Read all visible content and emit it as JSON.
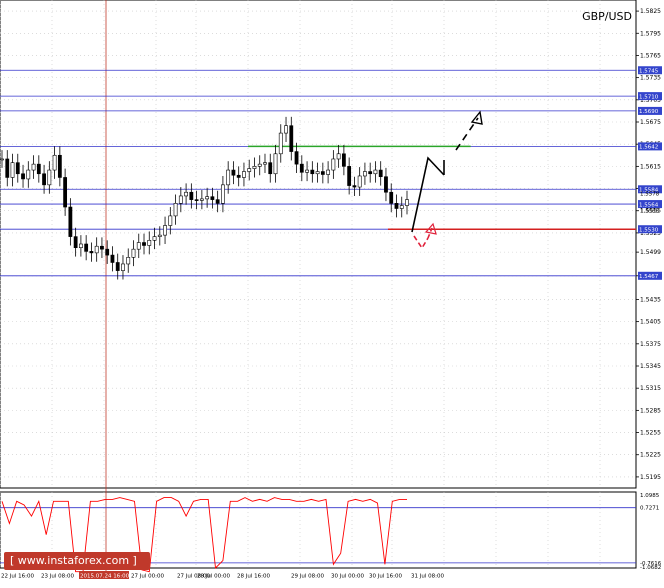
{
  "symbol": "GBP/USD",
  "watermark": "[ www.instaforex.com ]",
  "colors": {
    "grid": "#c8c8c8",
    "blue_level": "#3333cc",
    "green_level": "#2aa52a",
    "red_level": "#d42020",
    "candles": "#000000",
    "oscillator": "#ff0000",
    "arrow_black": "#000000",
    "arrow_red": "#e0203a",
    "date_marker": "#c0392b"
  },
  "chart_data": [
    {
      "type": "candlestick",
      "title": "GBP/USD",
      "y_ticks": [
        "1.5825",
        "1.5795",
        "1.5765",
        "1.5735",
        "1.5705",
        "1.5675",
        "1.5645",
        "1.5615",
        "1.5585",
        "1.5555",
        "1.5525",
        "1.5499",
        "1.5467",
        "1.5435",
        "1.5405",
        "1.5375",
        "1.5345",
        "1.5315",
        "1.5285",
        "1.5255",
        "1.5225",
        "1.5195"
      ],
      "x_ticks": [
        "22 Jul 16:00",
        "23 Jul 08:00",
        "2015.07.24 16:00",
        "27 Jul 00:00",
        "27 Jul 08:00",
        "28 Jul 00:00",
        "28 Jul 16:00",
        "29 Jul 08:00",
        "30 Jul 00:00",
        "30 Jul 16:00",
        "31 Jul 08:00"
      ],
      "ylim": [
        1.518,
        1.584
      ],
      "levels": [
        {
          "value": 1.5745,
          "label": "1.5745",
          "color": "blue"
        },
        {
          "value": 1.571,
          "label": "1.5710",
          "color": "blue"
        },
        {
          "value": 1.569,
          "label": "1.5690",
          "color": "blue"
        },
        {
          "value": 1.5642,
          "label": "1.5642",
          "color": "blue"
        },
        {
          "value": 1.5584,
          "label": "1.5584",
          "color": "blue"
        },
        {
          "value": 1.5564,
          "label": "1.5564",
          "color": "blue"
        },
        {
          "value": 1.553,
          "label": "1.5530",
          "color": "blue"
        },
        {
          "value": 1.5467,
          "label": "1.5467",
          "color": "blue"
        }
      ],
      "extra_price_labels": [
        "1.5578",
        "1.5555"
      ],
      "green_level": {
        "value": 1.5642,
        "from_pct": 0.39,
        "to_pct": 0.74
      },
      "red_level": {
        "value": 1.553,
        "from_pct": 0.61,
        "to_pct": 1.0
      },
      "close_path": [
        1.5625,
        1.56,
        1.562,
        1.5605,
        1.5598,
        1.561,
        1.5618,
        1.5605,
        1.559,
        1.561,
        1.563,
        1.56,
        1.556,
        1.552,
        1.5505,
        1.551,
        1.55,
        1.5498,
        1.5507,
        1.5503,
        1.5495,
        1.5485,
        1.5474,
        1.5483,
        1.5492,
        1.5503,
        1.5512,
        1.5508,
        1.5515,
        1.552,
        1.5522,
        1.5535,
        1.5548,
        1.5565,
        1.5575,
        1.558,
        1.557,
        1.5569,
        1.5571,
        1.5574,
        1.557,
        1.5565,
        1.559,
        1.561,
        1.5603,
        1.56,
        1.5608,
        1.5612,
        1.5615,
        1.5618,
        1.562,
        1.5605,
        1.5632,
        1.566,
        1.567,
        1.5635,
        1.5618,
        1.5607,
        1.561,
        1.5605,
        1.5608,
        1.5604,
        1.561,
        1.5625,
        1.5632,
        1.5615,
        1.5589,
        1.5587,
        1.5602,
        1.5608,
        1.5605,
        1.561,
        1.5601,
        1.558,
        1.5565,
        1.5558,
        1.5562,
        1.557
      ]
    },
    {
      "type": "line",
      "title": "",
      "ylim": [
        -0.9,
        1.15
      ],
      "y_ticks": [
        "1.0985",
        "0.7271",
        "-0.7616",
        "-1.0682"
      ],
      "values": [
        0.9,
        0.3,
        0.9,
        0.8,
        0.5,
        0.9,
        0.0,
        0.9,
        0.9,
        0.9,
        -1.0,
        -1.0,
        0.9,
        0.9,
        0.95,
        0.95,
        1.0,
        0.95,
        0.9,
        -0.95,
        -1.0,
        0.9,
        1.0,
        1.0,
        0.9,
        0.5,
        0.9,
        0.95,
        0.95,
        -0.9,
        -0.7,
        0.9,
        0.9,
        1.0,
        0.9,
        0.95,
        0.9,
        1.0,
        0.95,
        0.95,
        0.9,
        0.9,
        0.95,
        0.9,
        0.95,
        -0.8,
        -0.5,
        0.9,
        0.95,
        0.9,
        0.95,
        0.85,
        -0.8,
        0.9,
        0.95,
        0.95
      ]
    }
  ]
}
